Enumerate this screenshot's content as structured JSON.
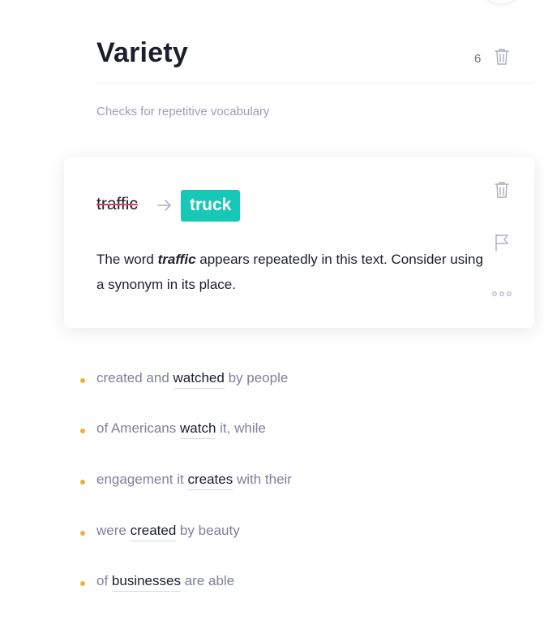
{
  "header": {
    "title": "Variety",
    "count": "6",
    "subtitle": "Checks for repetitive vocabulary"
  },
  "card": {
    "original": "traffic",
    "suggestion": "truck",
    "description": {
      "before": "The word ",
      "word": "traffic",
      "after": " appears repeatedly in this text. Consider using a synonym in its place."
    }
  },
  "occurrences": [
    {
      "before": "created and ",
      "word": "watched",
      "after": " by people"
    },
    {
      "before": "of Americans ",
      "word": "watch",
      "after": " it, while"
    },
    {
      "before": "engagement it ",
      "word": "creates",
      "after": " with their"
    },
    {
      "before": "were ",
      "word": "created",
      "after": " by beauty"
    },
    {
      "before": "of ",
      "word": "businesses",
      "after": " are able"
    }
  ],
  "colors": {
    "suggestion_bg": "#17c8b6",
    "strike": "#e0435b",
    "bullet": "#f2b136",
    "muted_text": "#7c8299"
  },
  "icons": {
    "header_trash": "trash-icon",
    "card_trash": "trash-icon",
    "flag": "flag-icon",
    "more": "more-icon",
    "arrow": "arrow-right-icon"
  }
}
